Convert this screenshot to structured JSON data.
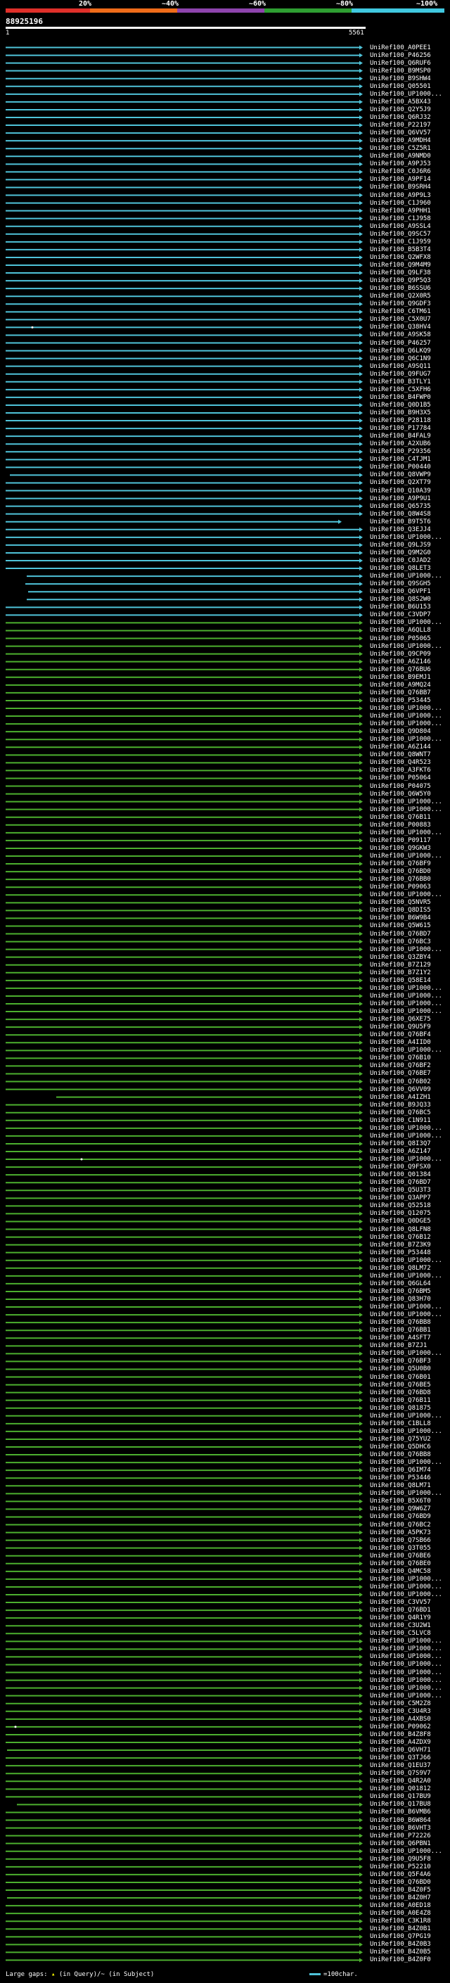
{
  "header": {
    "scale_labels": [
      "20%",
      "~40%",
      "~60%",
      "~80%",
      "~100%"
    ],
    "scale_colors": [
      "#e0302a",
      "#ef6c1a",
      "#8e44ad",
      "#2e9e32",
      "#40c8e0"
    ],
    "query_id": "88925196",
    "ruler_start": "1",
    "ruler_end": "5561"
  },
  "colors": {
    "cyan": "#4fc3d9",
    "green": "#4caf2e",
    "gap": "#ffff66"
  },
  "hits": [
    "UniRef100_A0PEE1",
    "UniRef100_P46256",
    "UniRef100_Q6RUF6",
    "UniRef100_B9MSP0",
    "UniRef100_B9SHW4",
    "UniRef100_Q05501",
    "UniRef100_UP1000...",
    "UniRef100_A5BX43",
    "UniRef100_Q2Y5J9",
    "UniRef100_Q6RJ32",
    "UniRef100_P22197",
    "UniRef100_Q6VV57",
    "UniRef100_A9MDH4",
    "UniRef100_C5Z5R1",
    "UniRef100_A9NMD0",
    "UniRef100_A9PJ53",
    "UniRef100_C0J6R6",
    "UniRef100_A9PF14",
    "UniRef100_B9SRH4",
    "UniRef100_A9P9L3",
    "UniRef100_C1J960",
    "UniRef100_A9PHH1",
    "UniRef100_C1J958",
    "UniRef100_A9SSL4",
    "UniRef100_Q9SC57",
    "UniRef100_C1J959",
    "UniRef100_B5B3T4",
    "UniRef100_Q2WFX8",
    "UniRef100_Q9M4M9",
    "UniRef100_Q9LF38",
    "UniRef100_Q9P5Q3",
    "UniRef100_B6SSU6",
    "UniRef100_Q2X0R5",
    "UniRef100_Q9GDF3",
    "UniRef100_C6TM61",
    "UniRef100_C5X0U7",
    "UniRef100_Q38HV4",
    "UniRef100_A9SK58",
    "UniRef100_P46257",
    "UniRef100_Q6LKQ9",
    "UniRef100_Q6C1N9",
    "UniRef100_A9SQ11",
    "UniRef100_Q9FUG7",
    "UniRef100_B3TLY1",
    "UniRef100_C5XFH6",
    "UniRef100_B4FWP0",
    "UniRef100_Q0D1B5",
    "UniRef100_B9H3X5",
    "UniRef100_P28118",
    "UniRef100_P17784",
    "UniRef100_B4FAL9",
    "UniRef100_A2XUB6",
    "UniRef100_P29356",
    "UniRef100_C4TJM1",
    "UniRef100_P00440",
    "UniRef100_Q8VWP9",
    "UniRef100_Q2XT79",
    "UniRef100_Q10A39",
    "UniRef100_A9P9U1",
    "UniRef100_Q65735",
    "UniRef100_Q8W4S8",
    "UniRef100_B9T5T6",
    "UniRef100_Q3EJJ4",
    "UniRef100_UP1000...",
    "UniRef100_Q9LJS9",
    "UniRef100_Q9M2G0",
    "UniRef100_C0JAD2",
    "UniRef100_Q8LET3",
    "UniRef100_UP1000...",
    "UniRef100_Q9SGH5",
    "UniRef100_Q6VPF1",
    "UniRef100_Q8S2W0",
    "UniRef100_B6U153",
    "UniRef100_C3VDP7",
    "UniRef100_UP1000...",
    "UniRef100_A6QLL8",
    "UniRef100_P05065",
    "UniRef100_UP1000...",
    "UniRef100_Q9CP09",
    "UniRef100_A6Z146",
    "UniRef100_Q76BU6",
    "UniRef100_B9EMJ1",
    "UniRef100_A9MQ24",
    "UniRef100_Q76BB7",
    "UniRef100_P53445",
    "UniRef100_UP1000...",
    "UniRef100_UP1000...",
    "UniRef100_UP1000...",
    "UniRef100_Q9D804",
    "UniRef100_UP1000...",
    "UniRef100_A6Z144",
    "UniRef100_Q8WNT7",
    "UniRef100_Q4R523",
    "UniRef100_A3FKT6",
    "UniRef100_P05064",
    "UniRef100_P04075",
    "UniRef100_Q6W5Y0",
    "UniRef100_UP1000...",
    "UniRef100_UP1000...",
    "UniRef100_Q76B11",
    "UniRef100_P00883",
    "UniRef100_UP1000...",
    "UniRef100_P09117",
    "UniRef100_Q9GKW3",
    "UniRef100_UP1000...",
    "UniRef100_Q76BF9",
    "UniRef100_Q76BD0",
    "UniRef100_Q76BB0",
    "UniRef100_P09063",
    "UniRef100_UP1000...",
    "UniRef100_Q5NVR5",
    "UniRef100_Q8DIS5",
    "UniRef100_B6W9B4",
    "UniRef100_Q5W615",
    "UniRef100_Q76BD7",
    "UniRef100_Q76BC3",
    "UniRef100_UP1000...",
    "UniRef100_Q3ZBY4",
    "UniRef100_B7Z129",
    "UniRef100_B7Z1Y2",
    "UniRef100_Q58E14",
    "UniRef100_UP1000...",
    "UniRef100_UP1000...",
    "UniRef100_UP1000...",
    "UniRef100_UP1000...",
    "UniRef100_Q6XE75",
    "UniRef100_Q9U5F9",
    "UniRef100_Q76BF4",
    "UniRef100_A4IID0",
    "UniRef100_UP1000...",
    "UniRef100_Q76B10",
    "UniRef100_Q76BF2",
    "UniRef100_Q76BE7",
    "UniRef100_Q76B02",
    "UniRef100_Q6VV09",
    "UniRef100_A4IZH1",
    "UniRef100_B9JQ33",
    "UniRef100_Q76BC5",
    "UniRef100_C1N911",
    "UniRef100_UP1000...",
    "UniRef100_UP1000...",
    "UniRef100_Q8I3Q7",
    "UniRef100_A6Z147",
    "UniRef100_UP1000...",
    "UniRef100_Q9FSX0",
    "UniRef100_Q01384",
    "UniRef100_Q76BD7",
    "UniRef100_Q5U3T3",
    "UniRef100_Q3APP7",
    "UniRef100_Q52518",
    "UniRef100_Q12075",
    "UniRef100_Q0DGE5",
    "UniRef100_Q8LFN8",
    "UniRef100_Q76B12",
    "UniRef100_B7Z3K9",
    "UniRef100_P53448",
    "UniRef100_UP1000...",
    "UniRef100_Q8LM72",
    "UniRef100_UP1000...",
    "UniRef100_Q6GL64",
    "UniRef100_Q76BM5",
    "UniRef100_Q83H70",
    "UniRef100_UP1000...",
    "UniRef100_UP1000...",
    "UniRef100_Q76BB8",
    "UniRef100_Q76BB1",
    "UniRef100_A4SFT7",
    "UniRef100_B7ZJ1",
    "UniRef100_UP1000...",
    "UniRef100_Q76BF3",
    "UniRef100_Q5U0B0",
    "UniRef100_Q76B01",
    "UniRef100_Q76BE5",
    "UniRef100_Q76BD8",
    "UniRef100_Q76B11",
    "UniRef100_Q81875",
    "UniRef100_UP1000...",
    "UniRef100_C1BLL8",
    "UniRef100_UP1000...",
    "UniRef100_Q75YU2",
    "UniRef100_Q5DHC6",
    "UniRef100_Q76BB8",
    "UniRef100_UP1000...",
    "UniRef100_Q6IM74",
    "UniRef100_P53446",
    "UniRef100_Q8LM71",
    "UniRef100_UP1000...",
    "UniRef100_B5X6T0",
    "UniRef100_Q9W6Z7",
    "UniRef100_Q76BD9",
    "UniRef100_Q76BC2",
    "UniRef100_A5PK73",
    "UniRef100_Q7SB66",
    "UniRef100_Q3T055",
    "UniRef100_Q76BE6",
    "UniRef100_Q76BE0",
    "UniRef100_Q4MC58",
    "UniRef100_UP1000...",
    "UniRef100_UP1000...",
    "UniRef100_UP1000...",
    "UniRef100_C3VV57",
    "UniRef100_Q76BD1",
    "UniRef100_Q4R1Y9",
    "UniRef100_C3U2W1",
    "UniRef100_C5LVC8",
    "UniRef100_UP1000...",
    "UniRef100_UP1000...",
    "UniRef100_UP1000...",
    "UniRef100_UP1000...",
    "UniRef100_UP1000...",
    "UniRef100_UP1000...",
    "UniRef100_UP1000...",
    "UniRef100_UP1000...",
    "UniRef100_C5M2Z8",
    "UniRef100_C3U4R3",
    "UniRef100_A4XBS0",
    "UniRef100_P09062",
    "UniRef100_B4Z8F8",
    "UniRef100_A4ZDX9",
    "UniRef100_Q6VH71",
    "UniRef100_Q3TJ66",
    "UniRef100_Q1EU37",
    "UniRef100_Q7S9V7",
    "UniRef100_Q4R2A0",
    "UniRef100_Q01812",
    "UniRef100_Q17BU9",
    "UniRef100_Q17BU8",
    "UniRef100_B6VMB6",
    "UniRef100_B6W864",
    "UniRef100_B6VHT3",
    "UniRef100_P72226",
    "UniRef100_Q6PBN1",
    "UniRef100_UP1000...",
    "UniRef100_Q9U5F8",
    "UniRef100_P52210",
    "UniRef100_Q5F4A6",
    "UniRef100_Q76BD0",
    "UniRef100_B4Z0F5",
    "UniRef100_B4Z0H7",
    "UniRef100_A0ED18",
    "UniRef100_A0E4Z8",
    "UniRef100_C3K1R8",
    "UniRef100_B4Z0B1",
    "UniRef100_Q7PG19",
    "UniRef100_B4Z0B3",
    "UniRef100_B4Z0B5",
    "UniRef100_B4Z0F0"
  ],
  "legend": {
    "label": "Large gaps:",
    "gap_query": "(in Query)/~ (in Subject)",
    "scale": "=100char."
  }
}
